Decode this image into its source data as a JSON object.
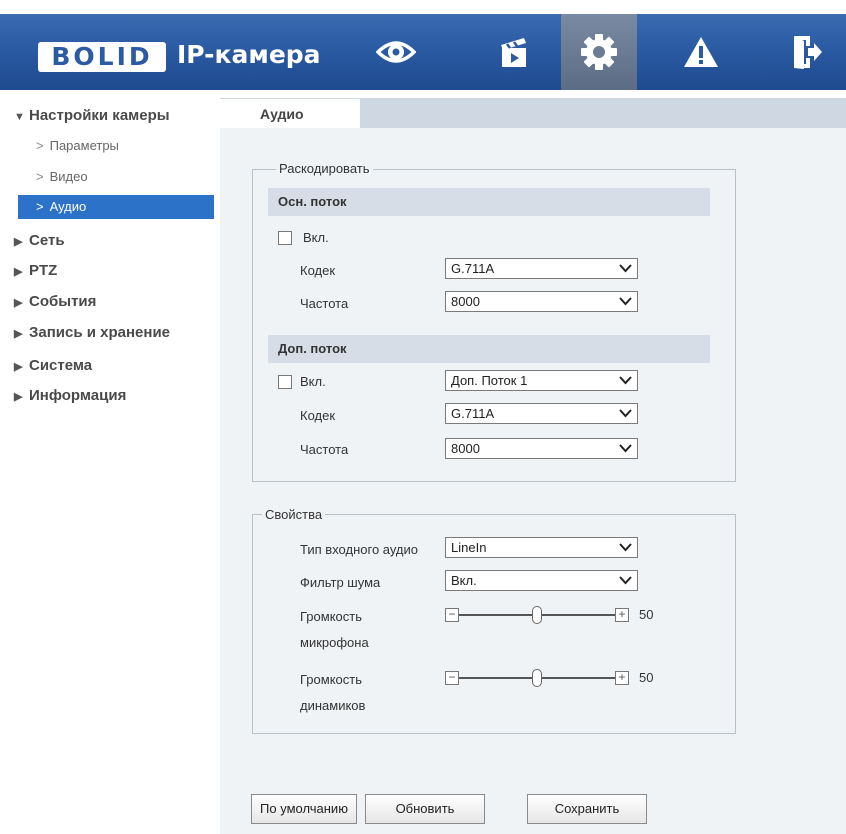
{
  "header": {
    "logo": "BOLID",
    "title": "IP-камера",
    "nav": [
      "eye-icon",
      "clapper-icon",
      "gear-icon",
      "warning-icon",
      "logout-icon"
    ]
  },
  "sidebar": {
    "camera_settings": "Настройки камеры",
    "sub_items": [
      "Параметры",
      "Видео",
      "Аудио"
    ],
    "sections": [
      "Сеть",
      "PTZ",
      "События",
      "Запись и хранение",
      "Система",
      "Информация"
    ]
  },
  "tab": "Аудио",
  "encode": {
    "legend": "Раскодировать",
    "main_stream": {
      "title": "Осн. поток",
      "enable_label": "Вкл.",
      "enabled": false,
      "codec_label": "Кодек",
      "codec_value": "G.711A",
      "rate_label": "Частота",
      "rate_value": "8000"
    },
    "sub_stream": {
      "title": "Доп. поток",
      "enable_label": "Вкл.",
      "enabled": false,
      "stream_value": "Доп. Поток 1",
      "codec_label": "Кодек",
      "codec_value": "G.711A",
      "rate_label": "Частота",
      "rate_value": "8000"
    }
  },
  "properties": {
    "legend": "Свойства",
    "input_type_label": "Тип входного аудио",
    "input_type_value": "LineIn",
    "noise_filter_label": "Фильтр шума",
    "noise_filter_value": "Вкл.",
    "mic_volume_label_1": "Громкость",
    "mic_volume_label_2": "микрофона",
    "mic_volume_value": "50",
    "mic_volume_level": 0.5,
    "spk_volume_label_1": "Громкость",
    "spk_volume_label_2": "динамиков",
    "spk_volume_value": "50",
    "spk_volume_level": 0.5
  },
  "buttons": {
    "default": "По умолчанию",
    "refresh": "Обновить",
    "save": "Сохранить"
  },
  "colors": {
    "header": "#2b5ba3",
    "selected": "#2b72c8"
  }
}
